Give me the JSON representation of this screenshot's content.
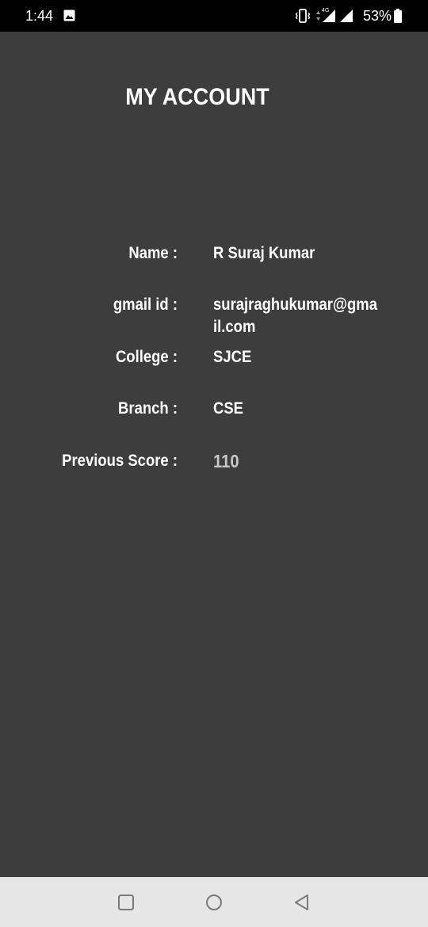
{
  "status_bar": {
    "time": "1:44",
    "network": "4G",
    "battery_percent": "53%",
    "icons": [
      "image-icon",
      "vibrate-icon",
      "data-arrows-icon",
      "signal-icon",
      "signal-icon",
      "battery-icon"
    ]
  },
  "page": {
    "title": "MY ACCOUNT"
  },
  "account": {
    "name_label": "Name :",
    "name_value": "R Suraj Kumar",
    "gmail_label": "gmail id :",
    "gmail_value": "surajraghukumar@gmail.com",
    "college_label": "College :",
    "college_value": "SJCE",
    "branch_label": "Branch :",
    "branch_value": "CSE",
    "score_label": "Previous Score :",
    "score_value": "110"
  },
  "nav_bar": {
    "buttons": [
      "recents-icon",
      "home-icon",
      "back-icon"
    ]
  },
  "colors": {
    "background": "#3d3d3d",
    "status_bar": "#000000",
    "nav_bar": "#e6e6e6",
    "text": "#ffffff",
    "score_text": "#c7c7c7"
  }
}
